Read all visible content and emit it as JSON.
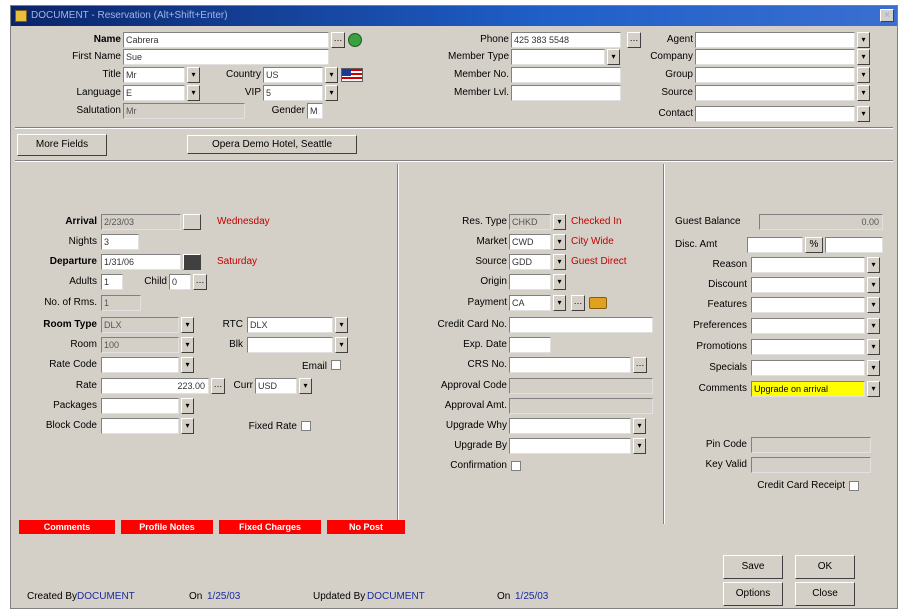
{
  "window": {
    "title": "DOCUMENT - Reservation (Alt+Shift+Enter)",
    "close_glyph": "×"
  },
  "profile": {
    "name_label": "Name",
    "name_value": "Cabrera",
    "first_name_label": "First Name",
    "first_name_value": "Sue",
    "title_label": "Title",
    "title_value": "Mr",
    "country_label": "Country",
    "country_value": "US",
    "language_label": "Language",
    "language_value": "E",
    "vip_label": "VIP",
    "vip_value": "5",
    "salutation_label": "Salutation",
    "salutation_value": "Mr",
    "gender_label": "Gender",
    "gender_value": "M",
    "phone_label": "Phone",
    "phone_value": "425 383 5548",
    "member_type_label": "Member Type",
    "member_type_value": "",
    "member_no_label": "Member No.",
    "member_no_value": "",
    "member_lvl_label": "Member Lvl.",
    "member_lvl_value": "",
    "agent_label": "Agent",
    "company_label": "Company",
    "group_label": "Group",
    "source_label": "Source",
    "contact_label": "Contact"
  },
  "toolbar": {
    "more_fields": "More Fields",
    "opera_demo": "Opera Demo Hotel, Seattle"
  },
  "stay": {
    "arrival_label": "Arrival",
    "arrival_value": "2/23/03",
    "arrival_day": "Wednesday",
    "nights_label": "Nights",
    "nights_value": "3",
    "departure_label": "Departure",
    "departure_value": "1/31/06",
    "departure_day": "Saturday",
    "adults_label": "Adults",
    "adults_value": "1",
    "child_label": "Child",
    "child_value": "0",
    "no_rms_label": "No. of Rms.",
    "no_rms_value": "1",
    "room_type_label": "Room Type",
    "room_type_value": "DLX",
    "rtc_label": "RTC",
    "rtc_value": "DLX",
    "room_label": "Room",
    "room_value": "100",
    "blk_label": "Blk",
    "rate_code_label": "Rate Code",
    "email_label": "Email",
    "rate_label": "Rate",
    "rate_value": "223.00",
    "curr_label": "Curr",
    "curr_value": "USD",
    "packages_label": "Packages",
    "block_code_label": "Block Code",
    "fixed_rate_label": "Fixed Rate"
  },
  "reservation": {
    "res_type_label": "Res. Type",
    "res_type_value": "CHKD",
    "res_type_note": "Checked In",
    "market_label": "Market",
    "market_value": "CWD",
    "market_note": "City Wide",
    "source_label": "Source",
    "source_value": "GDD",
    "source_note": "Guest Direct",
    "origin_label": "Origin",
    "payment_label": "Payment",
    "payment_value": "CA",
    "cc_no_label": "Credit Card No.",
    "exp_date_label": "Exp. Date",
    "crs_no_label": "CRS No.",
    "approval_code_label": "Approval Code",
    "approval_amt_label": "Approval Amt.",
    "upgrade_why_label": "Upgrade Why",
    "upgrade_by_label": "Upgrade By",
    "confirmation_label": "Confirmation"
  },
  "balance": {
    "guest_balance_label": "Guest Balance",
    "guest_balance_value": "0.00",
    "disc_amt_label": "Disc. Amt",
    "percent_glyph": "%",
    "reason_label": "Reason",
    "discount_label": "Discount",
    "features_label": "Features",
    "preferences_label": "Preferences",
    "promotions_label": "Promotions",
    "specials_label": "Specials",
    "comments_label": "Comments",
    "comments_value": "Upgrade on arrival",
    "pin_code_label": "Pin Code",
    "key_valid_label": "Key Valid",
    "cc_receipt_label": "Credit Card Receipt"
  },
  "tabs": [
    "Comments",
    "Profile Notes",
    "Fixed Charges",
    "No Post"
  ],
  "buttons": {
    "save": "Save",
    "ok": "OK",
    "options": "Options",
    "close": "Close"
  },
  "footer": {
    "created_by_label": "Created By",
    "created_by_value": "DOCUMENT",
    "created_on_label": "On",
    "created_on_value": "1/25/03",
    "updated_by_label": "Updated By",
    "updated_by_value": "DOCUMENT",
    "updated_on_label": "On",
    "updated_on_value": "1/25/03"
  },
  "icons": {
    "dropdown": "▾",
    "ellipsis": "…"
  },
  "colors": {
    "title_bar": "#0a246a",
    "red_tab": "#ff0000",
    "comment_highlight": "#ffff00",
    "accent_red_text": "#c00000"
  }
}
